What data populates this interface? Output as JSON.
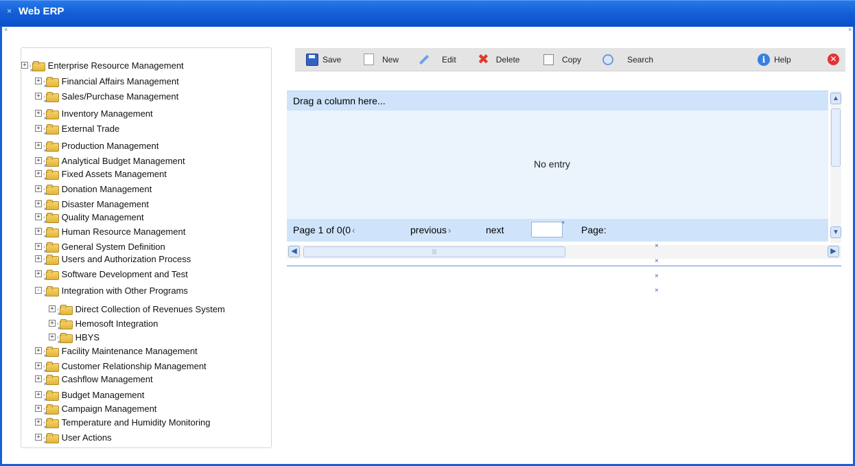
{
  "window": {
    "title": "Web ERP",
    "title_glyph": "×"
  },
  "tree": {
    "root": "Enterprise Resource Management",
    "items": [
      {
        "label": "Financial Affairs Management",
        "expanded": false
      },
      {
        "label": "Sales/Purchase Management",
        "expanded": false
      },
      {
        "label": "Inventory Management",
        "expanded": false
      },
      {
        "label": "External Trade",
        "expanded": false
      },
      {
        "label": "Production Management",
        "expanded": false
      },
      {
        "label": "Analytical Budget Management",
        "expanded": false
      },
      {
        "label": "Fixed Assets Management",
        "expanded": false
      },
      {
        "label": "Donation Management",
        "expanded": false
      },
      {
        "label": "Disaster Management",
        "expanded": false
      },
      {
        "label": "Quality Management",
        "expanded": false
      },
      {
        "label": "Human Resource Management",
        "expanded": false
      },
      {
        "label": "General System Definition",
        "expanded": false
      },
      {
        "label": "Users and Authorization Process",
        "expanded": false
      },
      {
        "label": "Software Development and Test",
        "expanded": false
      },
      {
        "label": "Integration with Other Programs",
        "expanded": true,
        "children": [
          {
            "label": "Direct Collection of Revenues System"
          },
          {
            "label": "Hemosoft Integration"
          },
          {
            "label": "HBYS"
          }
        ]
      },
      {
        "label": "Facility Maintenance Management",
        "expanded": false
      },
      {
        "label": "Customer Relationship Management",
        "expanded": false
      },
      {
        "label": "Cashflow Management",
        "expanded": false
      },
      {
        "label": "Budget Management",
        "expanded": false
      },
      {
        "label": "Campaign Management",
        "expanded": false
      },
      {
        "label": "Temperature and Humidity Monitoring",
        "expanded": false
      },
      {
        "label": "User Actions",
        "expanded": false
      }
    ]
  },
  "toolbar": {
    "save_label": "Save",
    "new_label": "New",
    "edit_label": "Edit",
    "delete_label": "Delete",
    "copy_label": "Copy",
    "search_label": "Search",
    "help_label": "Help"
  },
  "grid": {
    "group_hint": "Drag a column here...",
    "empty_text": "No entry",
    "pager": {
      "page_text": "Page 1 of 0(0",
      "previous_label": "previous",
      "next_label": "next",
      "page_input_value": "",
      "page_label": "Page:"
    }
  },
  "icons": {
    "expand": "+",
    "collapse": "-",
    "arrow": "›",
    "x_marker": "×",
    "scroll_up": "▲",
    "scroll_down": "▼",
    "scroll_left": "◀",
    "scroll_right": "▶",
    "help_glyph": "i",
    "close_glyph": "✕",
    "delete_glyph": "✖",
    "pager_prev_glyph": "‹",
    "pager_next_glyph": "›",
    "thumb_grip": "|||"
  },
  "colors": {
    "titlebar": "#1360d9",
    "grid_header": "#cfe4fb",
    "grid_body": "#ebf3fd",
    "toolbar_bg": "#e4e4e4"
  }
}
